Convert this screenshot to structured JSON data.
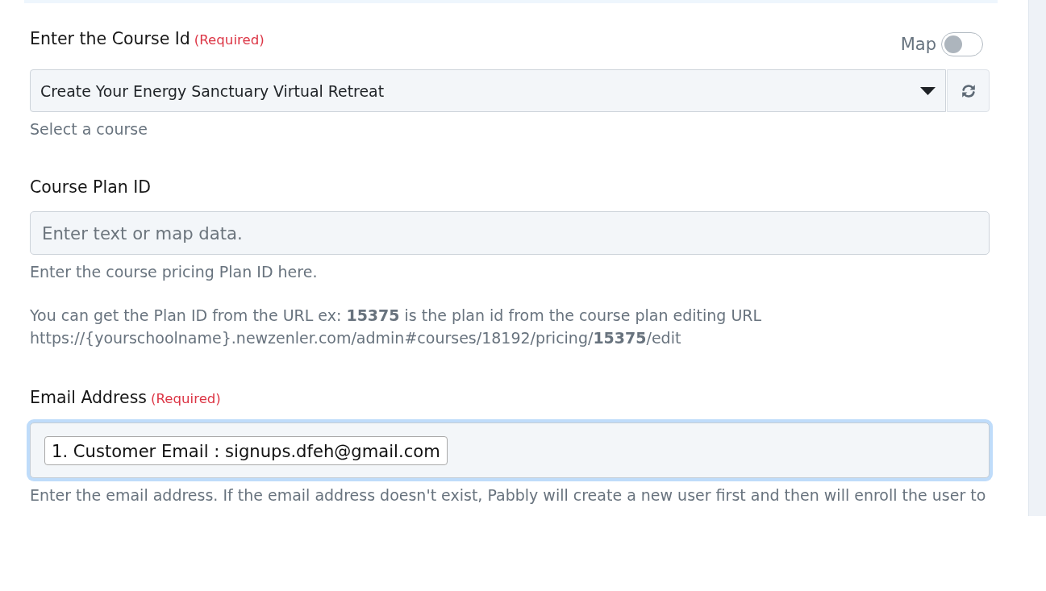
{
  "fields": [
    {
      "kind": "select",
      "label": "Enter the Course Id",
      "required_mark": "(Required)",
      "map_toggle": {
        "label": "Map",
        "on": false
      },
      "value": "Create Your Energy Sanctuary Virtual Retreat",
      "help": "Select a course"
    },
    {
      "kind": "text",
      "label": "Course Plan ID",
      "placeholder": "Enter text or map data.",
      "help": "Enter the course pricing Plan ID here.",
      "note": "You can get the Plan ID from the URL ex: **15375** is the plan id from the course plan editing URL\nhttps://{yourschoolname}.newzenler.com/admin#courses/18192/pricing/**15375**/edit"
    },
    {
      "kind": "tags",
      "label": "Email Address",
      "required_mark": "(Required)",
      "focused": true,
      "tags": [
        "1. Customer Email : signups.dfeh@gmail.com"
      ],
      "help": "Enter the email address. If the email address doesn't exist, Pabbly will create a new user first and then will enroll the user to"
    }
  ]
}
